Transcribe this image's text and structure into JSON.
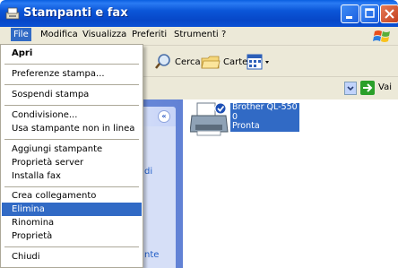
{
  "window": {
    "title": "Stampanti e fax"
  },
  "menubar": {
    "items": [
      "File",
      "Modifica",
      "Visualizza",
      "Preferiti",
      "Strumenti",
      "?"
    ],
    "active": "File"
  },
  "toolbar": {
    "search_label": "Cerca",
    "folders_label": "Cartelle"
  },
  "address": {
    "go_label": "Vai"
  },
  "left_pane": {
    "fragments": [
      "di",
      "nte"
    ]
  },
  "printer": {
    "name": "Brother QL-550",
    "jobs": "0",
    "status": "Pronta"
  },
  "file_menu": {
    "items": [
      "Apri",
      "Preferenze stampa...",
      "Sospendi stampa",
      "Condivisione...",
      "Usa stampante non in linea",
      "Aggiungi stampante",
      "Proprietà server",
      "Installa fax",
      "Crea collegamento",
      "Elimina",
      "Rinomina",
      "Proprietà",
      "Chiudi"
    ],
    "highlighted": "Elimina"
  },
  "colors": {
    "title_blue": "#0747c8",
    "selection": "#316ac5",
    "menu_bg": "#ece9d8",
    "task_pane": "#6282d5"
  }
}
